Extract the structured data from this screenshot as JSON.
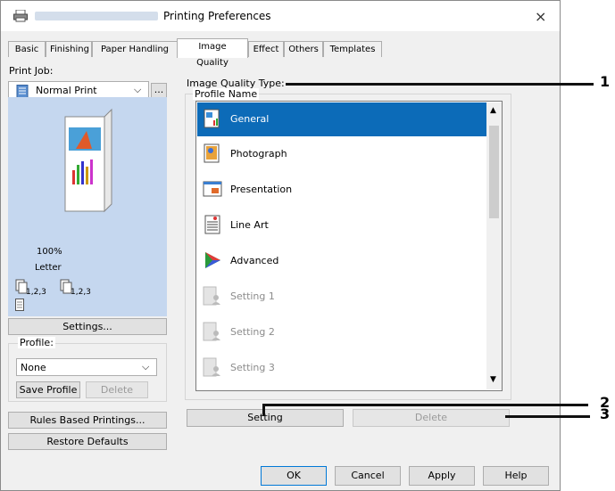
{
  "window": {
    "title": "Printing Preferences",
    "close": "×"
  },
  "tabs": [
    "Basic",
    "Finishing",
    "Paper Handling",
    "Image Quality",
    "Effect",
    "Others",
    "Templates"
  ],
  "left": {
    "print_job_label": "Print Job:",
    "print_job_value": "Normal Print",
    "more_button": "...",
    "zoom": "100%",
    "paper": "Letter",
    "copies_a": "1,2,3",
    "copies_b": "1,2,3",
    "settings_button": "Settings...",
    "profile_label": "Profile:",
    "profile_value": "None",
    "save_profile": "Save Profile",
    "delete_profile": "Delete",
    "rules_button": "Rules Based Printings...",
    "restore_button": "Restore Defaults"
  },
  "right": {
    "iq_type_label": "Image Quality Type:",
    "profile_name_label": "Profile Name",
    "profiles": [
      {
        "name": "General",
        "icon": "general-icon",
        "selected": true
      },
      {
        "name": "Photograph",
        "icon": "photograph-icon"
      },
      {
        "name": "Presentation",
        "icon": "presentation-icon"
      },
      {
        "name": "Line Art",
        "icon": "line-art-icon"
      },
      {
        "name": "Advanced",
        "icon": "advanced-icon"
      },
      {
        "name": "Setting 1",
        "icon": "custom-setting-icon",
        "disabled": true
      },
      {
        "name": "Setting 2",
        "icon": "custom-setting-icon",
        "disabled": true
      },
      {
        "name": "Setting 3",
        "icon": "custom-setting-icon",
        "disabled": true
      }
    ],
    "setting_button": "Setting",
    "delete_button": "Delete"
  },
  "footer": {
    "ok": "OK",
    "cancel": "Cancel",
    "apply": "Apply",
    "help": "Help"
  },
  "callouts": [
    "1",
    "2",
    "3"
  ],
  "colors": {
    "selection": "#0c6bb8",
    "preview_bg": "#c5d7ef"
  }
}
